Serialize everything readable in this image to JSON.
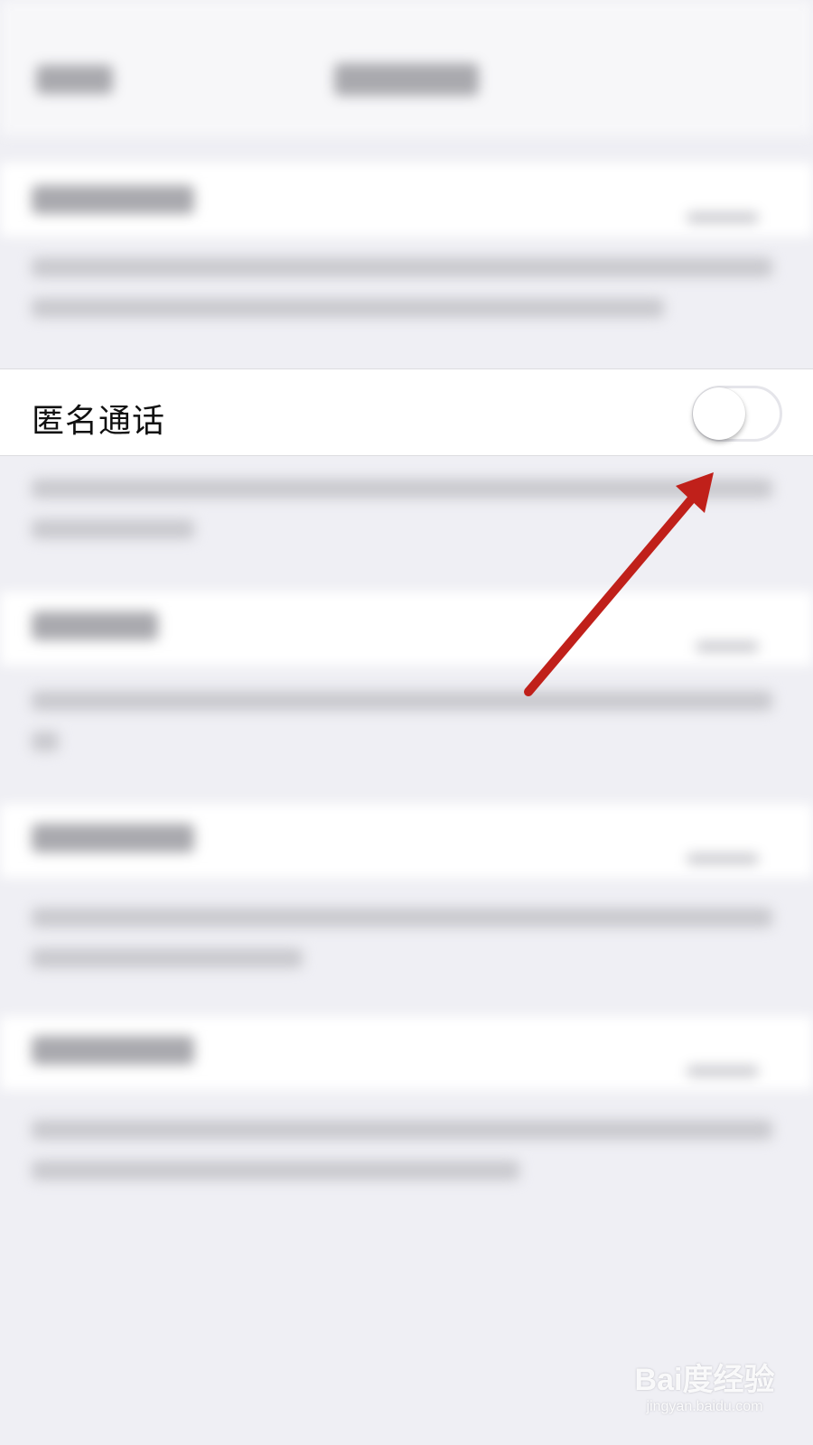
{
  "setting": {
    "label": "匿名通话",
    "enabled": false
  },
  "colors": {
    "background": "#efeff4",
    "arrow": "#c0201a",
    "toggle_off_track": "#e5e5ea"
  },
  "watermark": {
    "logo": "Bai度经验",
    "url": "jingyan.baidu.com"
  }
}
